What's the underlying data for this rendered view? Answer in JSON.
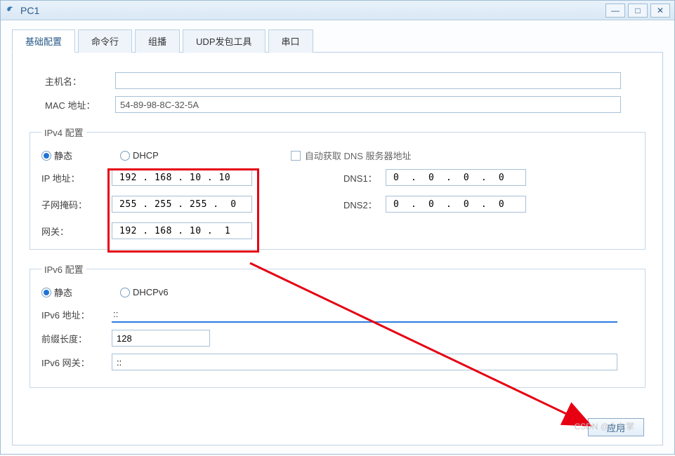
{
  "window": {
    "title": "PC1"
  },
  "tabs": {
    "basic": "基础配置",
    "cmd": "命令行",
    "multicast": "组播",
    "udp": "UDP发包工具",
    "serial": "串口"
  },
  "host": {
    "host_label": "主机名：",
    "host_value": "",
    "mac_label": "MAC 地址：",
    "mac_value": "54-89-98-8C-32-5A"
  },
  "ipv4": {
    "legend": "IPv4 配置",
    "static_label": "静态",
    "dhcp_label": "DHCP",
    "auto_dns_label": "自动获取 DNS 服务器地址",
    "ip_label": "IP 地址：",
    "ip_value": "192 . 168 . 10 . 10",
    "mask_label": "子网掩码：",
    "mask_value": "255 . 255 . 255 .  0",
    "gw_label": "网关：",
    "gw_value": "192 . 168 . 10 .  1",
    "dns1_label": "DNS1：",
    "dns1_value": "0  .  0  .  0  .  0",
    "dns2_label": "DNS2：",
    "dns2_value": "0  .  0  .  0  .  0"
  },
  "ipv6": {
    "legend": "IPv6 配置",
    "static_label": "静态",
    "dhcp_label": "DHCPv6",
    "addr_label": "IPv6 地址：",
    "addr_value": "::",
    "prefix_label": "前缀长度：",
    "prefix_value": "128",
    "gw_label": "IPv6 网关：",
    "gw_value": "::"
  },
  "buttons": {
    "apply": "应用"
  },
  "watermark": "CSDN @十七掌"
}
